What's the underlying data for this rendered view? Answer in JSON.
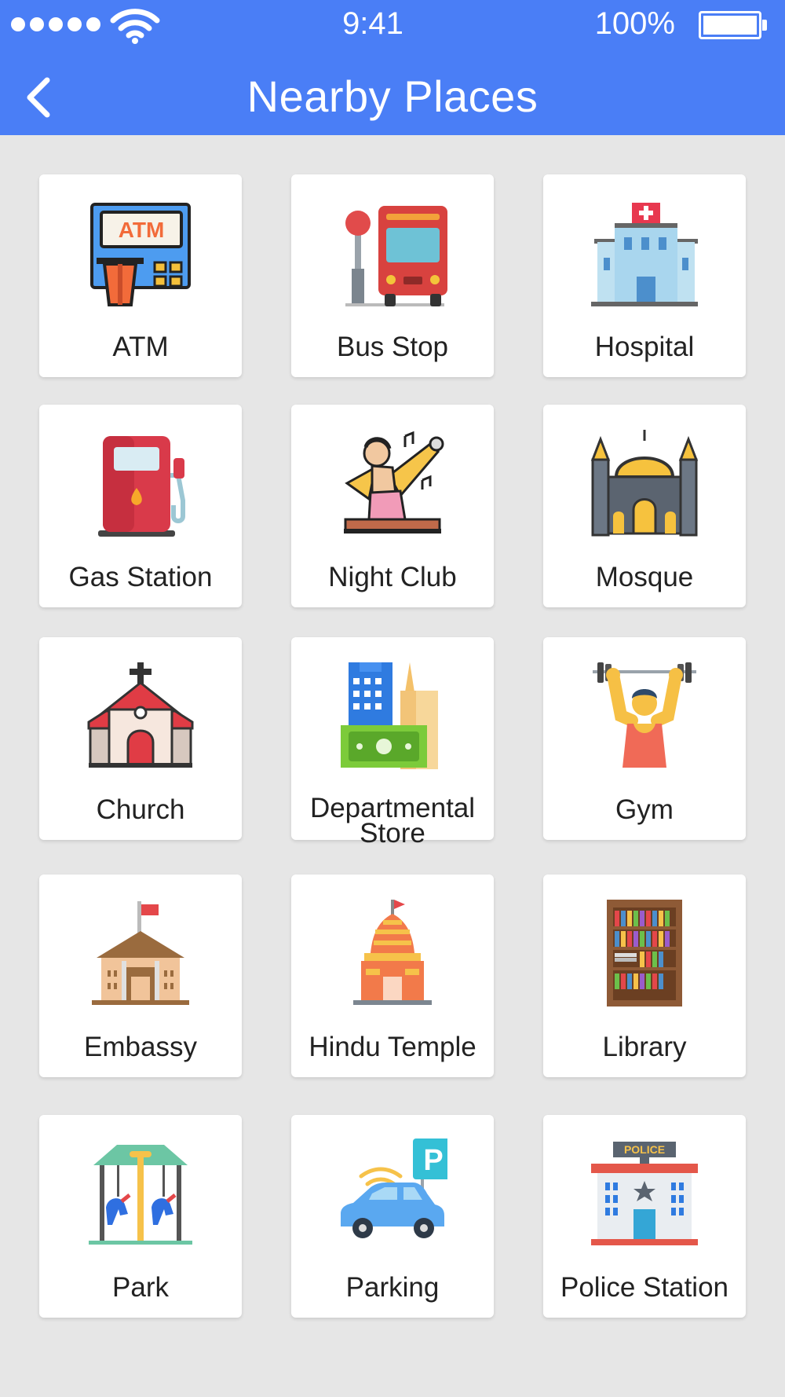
{
  "status_bar": {
    "time": "9:41",
    "battery": "100%",
    "battery_level": 1.0,
    "signal_bars": 5
  },
  "header": {
    "title": "Nearby Places",
    "back_icon": "chevron-left-icon",
    "background": "#4a7ef6"
  },
  "places": [
    {
      "label": "ATM",
      "icon": "atm-icon"
    },
    {
      "label": "Bus Stop",
      "icon": "bus-stop-icon"
    },
    {
      "label": "Hospital",
      "icon": "hospital-icon"
    },
    {
      "label": "Gas Station",
      "icon": "gas-station-icon"
    },
    {
      "label": "Night Club",
      "icon": "night-club-icon"
    },
    {
      "label": "Mosque",
      "icon": "mosque-icon"
    },
    {
      "label": "Church",
      "icon": "church-icon"
    },
    {
      "label": "Departmental Store",
      "icon": "departmental-store-icon"
    },
    {
      "label": "Gym",
      "icon": "gym-icon"
    },
    {
      "label": "Embassy",
      "icon": "embassy-icon"
    },
    {
      "label": "Hindu Temple",
      "icon": "hindu-temple-icon"
    },
    {
      "label": "Library",
      "icon": "library-icon"
    },
    {
      "label": "Park",
      "icon": "park-icon"
    },
    {
      "label": "Parking",
      "icon": "parking-icon"
    },
    {
      "label": "Police Station",
      "icon": "police-station-icon"
    }
  ]
}
